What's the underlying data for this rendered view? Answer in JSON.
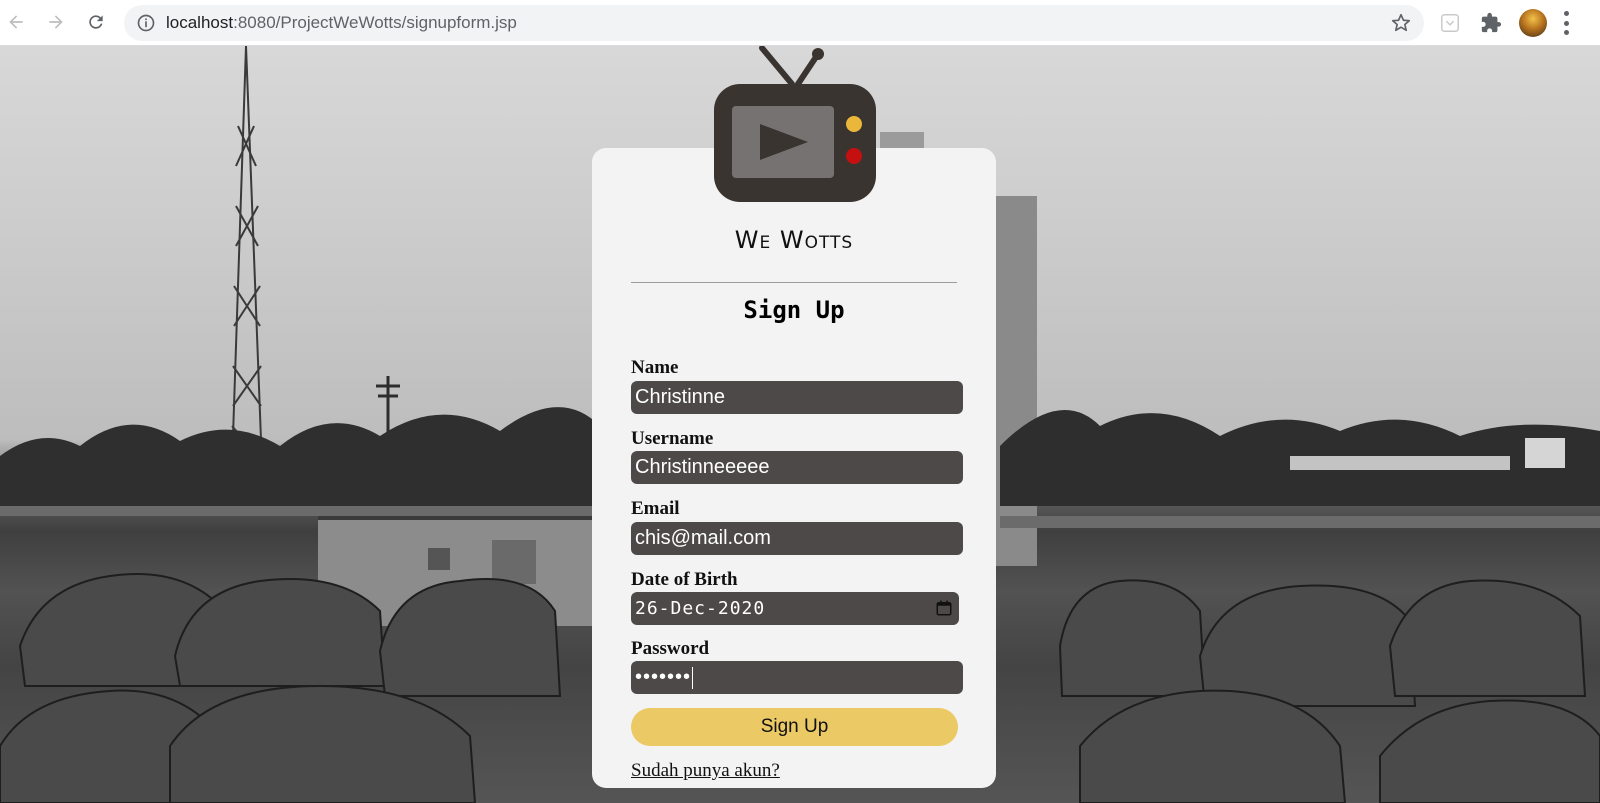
{
  "browser": {
    "url_host": "localhost",
    "url_rest": ":8080/ProjectWeWotts/signupform.jsp"
  },
  "brand": {
    "name": "We Wotts"
  },
  "form": {
    "title": "Sign Up",
    "name_label": "Name",
    "name_value": "Christinne",
    "username_label": "Username",
    "username_value": "Christinneeeee",
    "email_label": "Email",
    "email_value": "chis@mail.com",
    "dob_label": "Date of Birth",
    "dob_value": "26-Dec-2020",
    "password_label": "Password",
    "password_masked": "•••••••",
    "submit_label": "Sign Up",
    "login_link": "Sudah punya akun?"
  },
  "colors": {
    "card_bg": "#f3f3f3",
    "field_bg": "#4d4949",
    "button_bg": "#ebc965",
    "tv_body": "#3a3431",
    "tv_screen": "#777272",
    "tv_knob_top": "#ebb73a",
    "tv_knob_bottom": "#c41010"
  },
  "icons": [
    "back-arrow-icon",
    "forward-arrow-icon",
    "reload-icon",
    "info-icon",
    "star-icon",
    "pocket-icon",
    "extensions-puzzle-icon",
    "menu-dots-icon",
    "calendar-icon",
    "tv-logo-icon"
  ]
}
